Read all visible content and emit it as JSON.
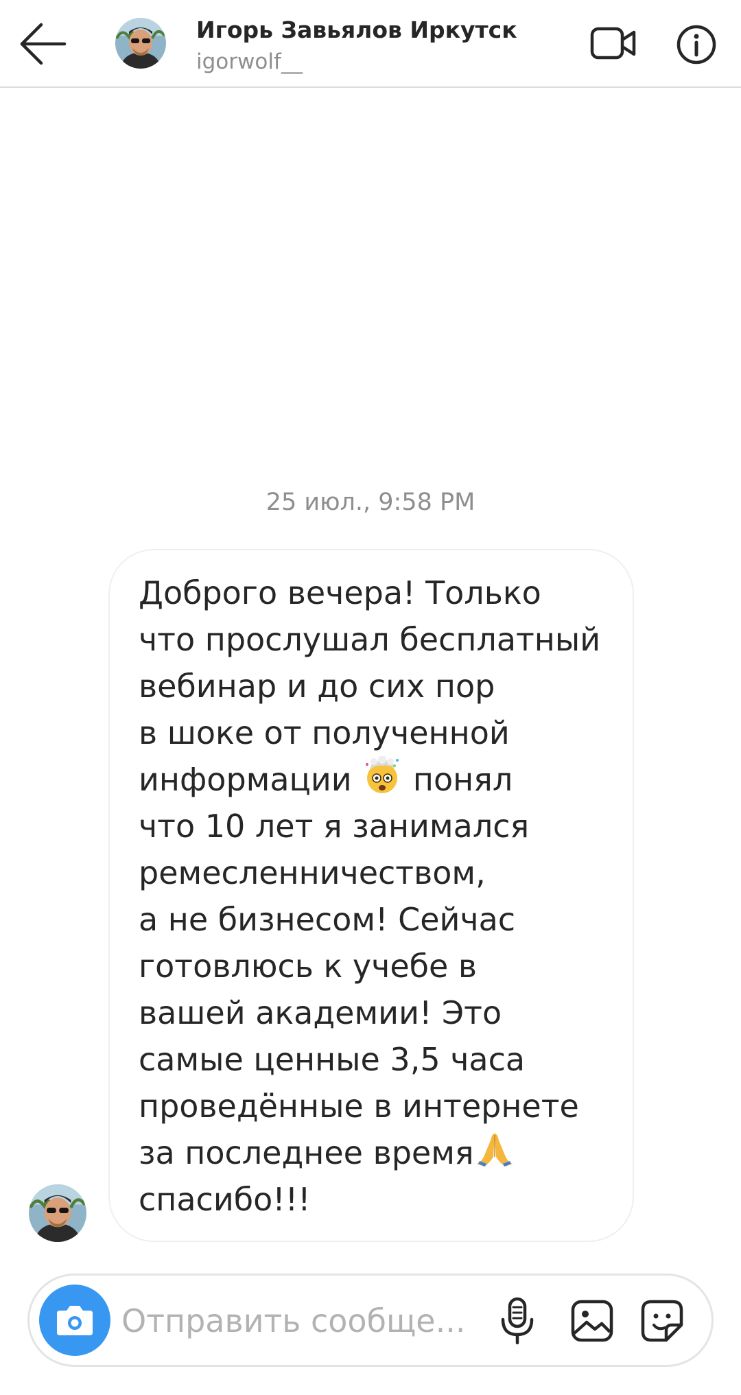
{
  "header": {
    "display_name": "Игорь Завьялов Иркутск",
    "username": "igorwolf__",
    "back_icon": "arrow-left-icon",
    "video_icon": "video-camera-icon",
    "info_icon": "info-icon"
  },
  "thread": {
    "timestamp": "25 июл., 9:58 PM",
    "message": {
      "lines": [
        "Доброго вечера! Только",
        "что прослушал бесплатный",
        "вебинар и до сих пор",
        "в шоке от полученной",
        "информации",
        "понял",
        "что 10 лет я занимался",
        "ремесленничеством,",
        "а не бизнесом! Сейчас",
        "готовлюсь к учебе в",
        "вашей академии! Это",
        "самые ценные 3,5 часа",
        "проведённые в интернете",
        "за последнее время",
        "спасибо!!!"
      ],
      "emojis": [
        "exploding-head-emoji",
        "folded-hands-emoji"
      ]
    }
  },
  "composer": {
    "placeholder": "Отправить сообще...",
    "value": "",
    "camera_icon": "camera-icon",
    "mic_icon": "microphone-icon",
    "gallery_icon": "gallery-icon",
    "sticker_icon": "sticker-icon"
  },
  "colors": {
    "accent": "#3897f0",
    "text": "#262626",
    "secondary_text": "#8e8e8e",
    "divider": "#dbdbdb",
    "bubble_border": "#efefef"
  }
}
